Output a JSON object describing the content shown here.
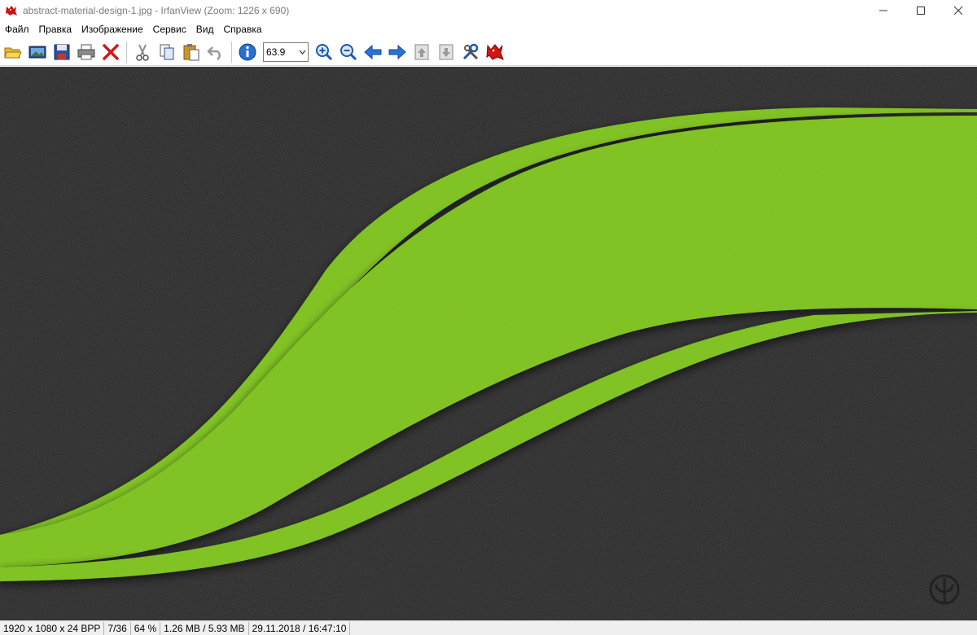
{
  "window": {
    "title": "abstract-material-design-1.jpg - IrfanView (Zoom: 1226 x 690)",
    "app_icon": "irfanview-devil-icon"
  },
  "menu": {
    "items": [
      "Файл",
      "Правка",
      "Изображение",
      "Сервис",
      "Вид",
      "Справка"
    ]
  },
  "toolbar": {
    "zoom_value": "63.9",
    "icons": [
      "open-folder-icon",
      "slideshow-icon",
      "save-icon",
      "print-icon",
      "delete-icon",
      "cut-icon",
      "copy-icon",
      "paste-icon",
      "undo-icon",
      "info-icon",
      "zoom-in-icon",
      "zoom-out-icon",
      "previous-icon",
      "next-icon",
      "first-page-icon",
      "last-page-icon",
      "settings-icon",
      "irfanview-devil-icon"
    ]
  },
  "image": {
    "background_color": "#262626",
    "accent_color": "#7ec31d",
    "watermark_icon": "watermark-logo-icon"
  },
  "status": {
    "dimensions": "1920 x 1080 x 24 BPP",
    "index": "7/36",
    "zoom_percent": "64 %",
    "file_size": "1.26 MB / 5.93 MB",
    "datetime": "29.11.2018 / 16:47:10"
  }
}
